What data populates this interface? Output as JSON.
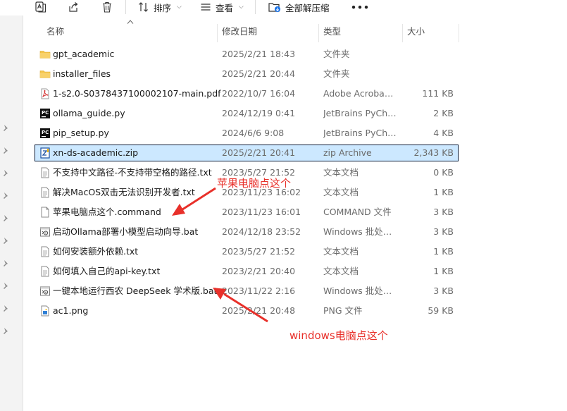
{
  "toolbar": {
    "sort_label": "排序",
    "view_label": "查看",
    "extract_all_label": "全部解压缩",
    "more_label": "•••"
  },
  "columns": {
    "name": "名称",
    "date": "修改日期",
    "type": "类型",
    "size": "大小"
  },
  "files": [
    {
      "icon": "folder-icon",
      "name": "gpt_academic",
      "date": "2025/2/21 18:43",
      "type": "文件夹",
      "size": ""
    },
    {
      "icon": "folder-icon",
      "name": "installer_files",
      "date": "2025/2/21 20:44",
      "type": "文件夹",
      "size": ""
    },
    {
      "icon": "pdf-icon",
      "name": "1-s2.0-S0378437100002107-main.pdf",
      "date": "2022/10/7 16:04",
      "type": "Adobe Acrobat ...",
      "size": "111 KB"
    },
    {
      "icon": "pycharm-icon",
      "name": "ollama_guide.py",
      "date": "2024/12/19 0:41",
      "type": "JetBrains PyChar...",
      "size": "2 KB"
    },
    {
      "icon": "pycharm-icon",
      "name": "pip_setup.py",
      "date": "2024/6/6 9:08",
      "type": "JetBrains PyChar...",
      "size": "4 KB"
    },
    {
      "icon": "zip-icon",
      "name": "xn-ds-academic.zip",
      "date": "2025/2/21 20:41",
      "type": "zip Archive",
      "size": "2,343 KB"
    },
    {
      "icon": "text-file-icon",
      "name": "不支持中文路径-不支持带空格的路径.txt",
      "date": "2023/5/27 21:52",
      "type": "文本文档",
      "size": "0 KB"
    },
    {
      "icon": "text-file-icon",
      "name": "解决MacOS双击无法识别开发者.txt",
      "date": "2023/11/23 16:02",
      "type": "文本文档",
      "size": "1 KB"
    },
    {
      "icon": "blank-file-icon",
      "name": "苹果电脑点这个.command",
      "date": "2023/11/23 16:01",
      "type": "COMMAND 文件",
      "size": "3 KB"
    },
    {
      "icon": "bat-file-icon",
      "name": "启动Ollama部署小模型启动向导.bat",
      "date": "2024/12/18 23:52",
      "type": "Windows 批处理...",
      "size": "3 KB"
    },
    {
      "icon": "text-file-icon",
      "name": "如何安装额外依赖.txt",
      "date": "2023/5/27 21:52",
      "type": "文本文档",
      "size": "1 KB"
    },
    {
      "icon": "text-file-icon",
      "name": "如何填入自己的api-key.txt",
      "date": "2023/2/21 20:40",
      "type": "文本文档",
      "size": "1 KB"
    },
    {
      "icon": "bat-file-icon",
      "name": "一键本地运行西农 DeepSeek 学术版.bat",
      "date": "2023/11/22 2:16",
      "type": "Windows 批处理...",
      "size": "3 KB"
    },
    {
      "icon": "png-file-icon",
      "name": "ac1.png",
      "date": "2025/2/21 20:48",
      "type": "PNG 文件",
      "size": "59 KB"
    }
  ],
  "annotations": {
    "mac": "苹果电脑点这个",
    "windows": "windows电脑点这个"
  },
  "colors": {
    "annotation": "#e8302a",
    "selected_row": "#cce8ff",
    "folder": "#f4c44a"
  }
}
